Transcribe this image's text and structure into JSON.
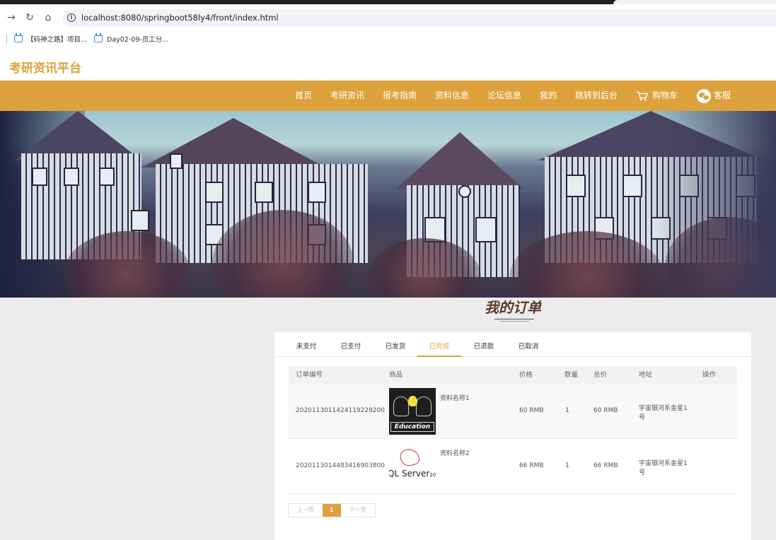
{
  "browser": {
    "url": "localhost:8080/springboot58ly4/front/index.html",
    "bookmarks": [
      {
        "label": "【码神之路】项目..."
      },
      {
        "label": "Day02-09-员工分..."
      }
    ]
  },
  "site": {
    "logo": "考研资讯平台",
    "nav": [
      {
        "label": "首页"
      },
      {
        "label": "考研资讯"
      },
      {
        "label": "报考指南"
      },
      {
        "label": "资料信息"
      },
      {
        "label": "论坛信息"
      },
      {
        "label": "我的"
      },
      {
        "label": "跳转到后台"
      },
      {
        "label": "购物车",
        "icon": "cart-icon"
      },
      {
        "label": "客服",
        "icon": "wechat-icon"
      }
    ]
  },
  "orders": {
    "title": "我的订单",
    "tabs": [
      {
        "label": "未支付"
      },
      {
        "label": "已支付"
      },
      {
        "label": "已发货"
      },
      {
        "label": "已完成",
        "active": true
      },
      {
        "label": "已退款"
      },
      {
        "label": "已取消"
      }
    ],
    "columns": [
      "订单编号",
      "商品",
      "价格",
      "数量",
      "总价",
      "地址",
      "操作"
    ],
    "rows": [
      {
        "order_no": "20201130114241192292​00",
        "product_name": "资料名称1",
        "thumb_text": "Education",
        "price": "60 RMB",
        "qty": "1",
        "total": "60 RMB",
        "address_line1": "宇宙银河系金星1",
        "address_line2": "号"
      },
      {
        "order_no": "20201130144834169038​00",
        "product_name": "资料名称2",
        "thumb_text": "QL Server",
        "thumb_small": "201",
        "price": "66 RMB",
        "qty": "1",
        "total": "66 RMB",
        "address_line1": "宇宙银河系金星1",
        "address_line2": "号"
      }
    ],
    "pager": {
      "prev": "上一页",
      "current": "1",
      "next": "下一页"
    }
  },
  "colors": {
    "accent": "#dda23b",
    "logo": "#daa33a"
  }
}
